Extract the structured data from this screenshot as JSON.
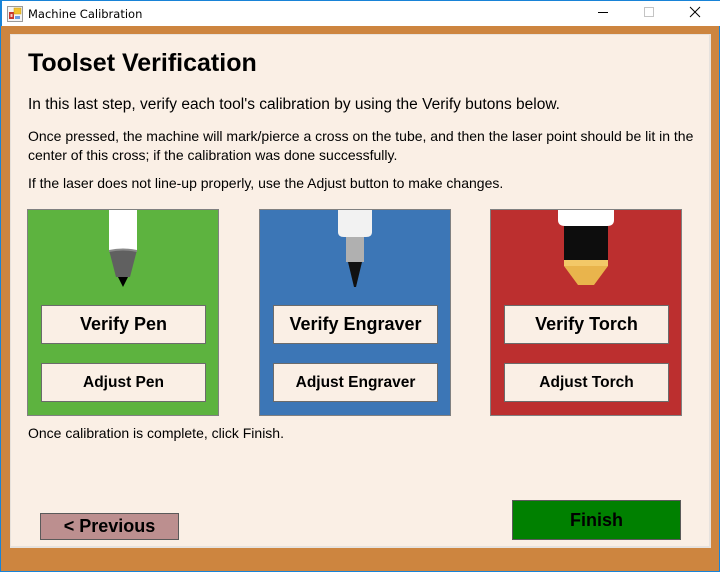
{
  "window": {
    "title": "Machine Calibration",
    "app_icon": "form-application-icon",
    "controls": {
      "minimize_icon": "minimize-icon",
      "maximize_icon": "maximize-icon",
      "close_icon": "close-icon"
    }
  },
  "page": {
    "heading": "Toolset Verification",
    "intro": "In this last step, verify each tool's calibration by using the Verify butons below.",
    "instructions": "Once pressed, the machine will mark/pierce a cross on the tube, and then the laser point should be lit in the center of this cross; if the calibration was done successfully.",
    "adjust_hint": "If the laser does not line-up properly, use the Adjust button to make changes.",
    "completion_note": "Once calibration is complete, click Finish."
  },
  "tools": [
    {
      "name": "Pen",
      "icon": "pen-icon",
      "color": "#5db33f",
      "verify_label": "Verify Pen",
      "adjust_label": "Adjust Pen"
    },
    {
      "name": "Engraver",
      "icon": "engraver-icon",
      "color": "#3c76b6",
      "verify_label": "Verify Engraver",
      "adjust_label": "Adjust Engraver"
    },
    {
      "name": "Torch",
      "icon": "torch-icon",
      "color": "#bc2f2f",
      "verify_label": "Verify Torch",
      "adjust_label": "Adjust Torch"
    }
  ],
  "navigation": {
    "previous_label": "< Previous",
    "finish_label": "Finish",
    "previous_color": "#bc8f8f",
    "finish_color": "#008000"
  },
  "theme": {
    "frame_color": "#cd853f",
    "content_background": "#faefe5",
    "titlebar_border": "#1883d7"
  }
}
